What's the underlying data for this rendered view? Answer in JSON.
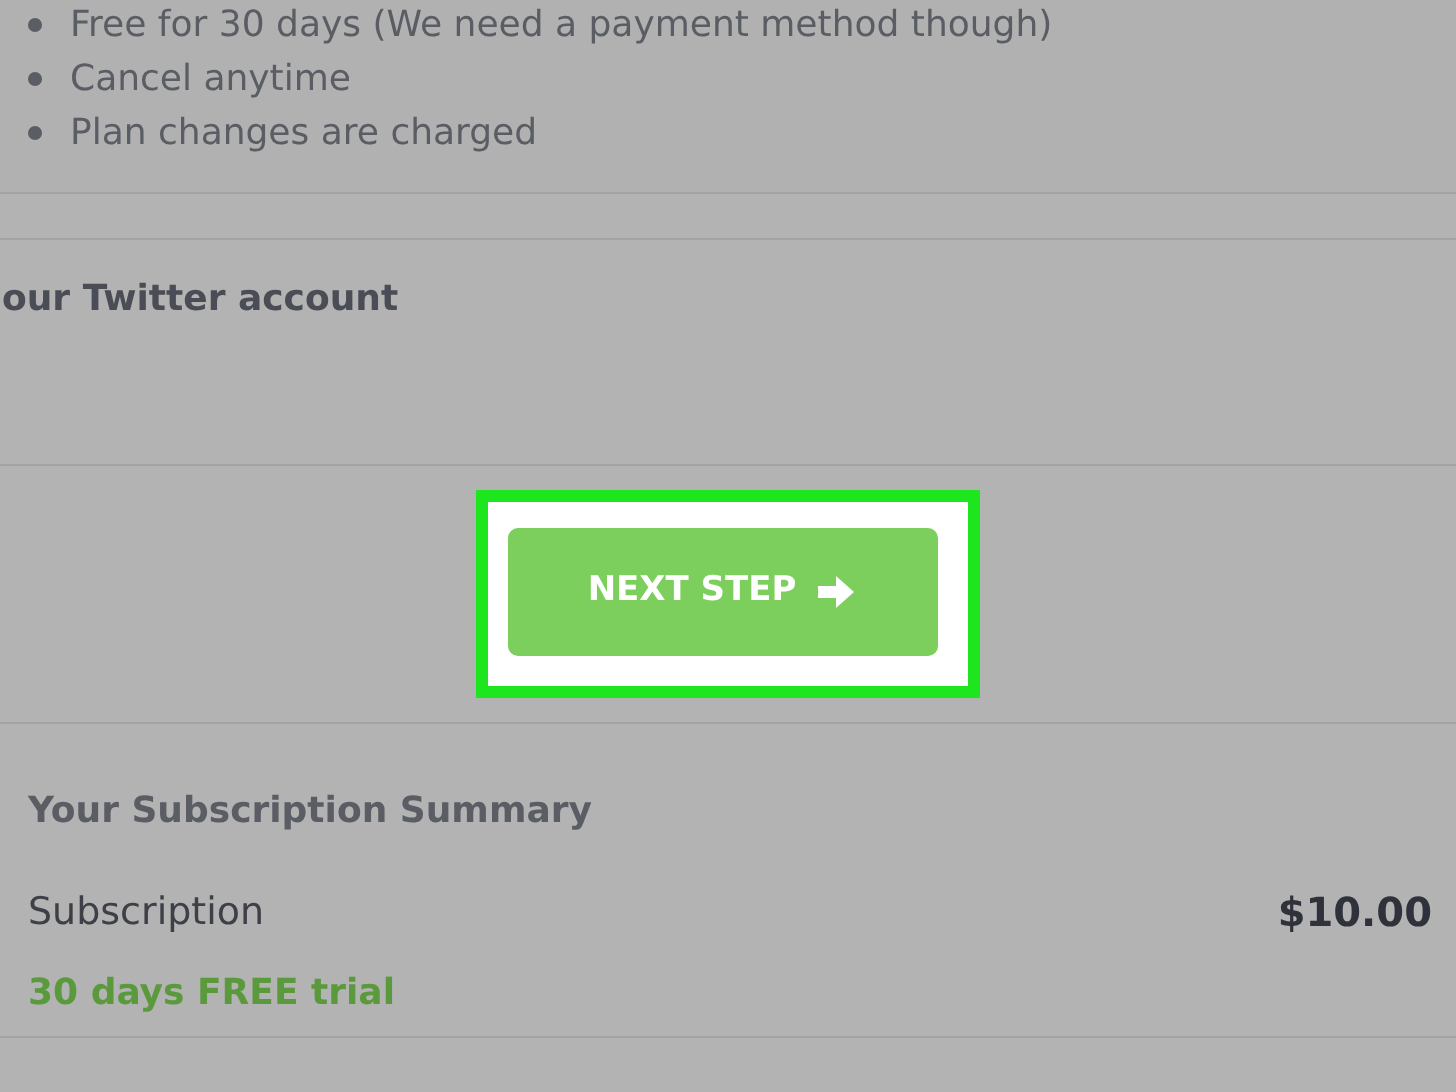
{
  "plan_features": [
    "Free for 30 days (We need a payment method though)",
    "Cancel anytime",
    "Plan changes are charged"
  ],
  "twitter_section": {
    "title": "our Twitter account"
  },
  "next_button": {
    "label": "NEXT STEP",
    "highlighted": true
  },
  "summary": {
    "title": "Your Subscription Summary",
    "rows": [
      {
        "kind": "price",
        "label": "Subscription",
        "value": "$10.00"
      },
      {
        "kind": "trial",
        "label": "30 days FREE trial"
      }
    ]
  }
}
